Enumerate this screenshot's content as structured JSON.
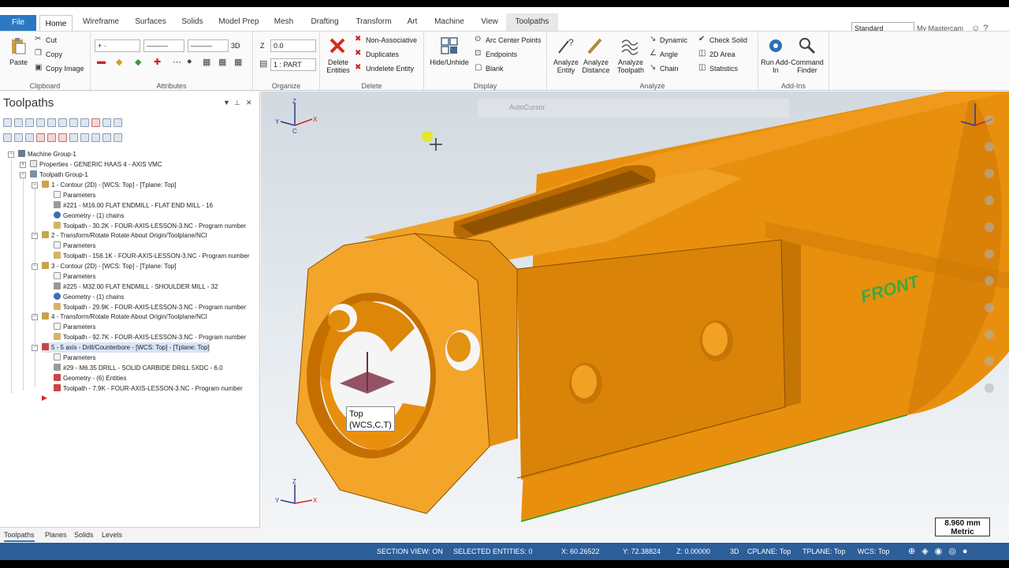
{
  "ribbon_tabs": [
    "File",
    "Home",
    "Wireframe",
    "Surfaces",
    "Solids",
    "Model Prep",
    "Mesh",
    "Drafting",
    "Transform",
    "Art",
    "Machine",
    "View",
    "Toolpaths"
  ],
  "active_tab": "Home",
  "top_right": {
    "standard": "Standard",
    "my_mastercam": "My Mastercam"
  },
  "clipboard": {
    "paste": "Paste",
    "cut": "Cut",
    "copy": "Copy",
    "copy_image": "Copy Image",
    "label": "Clipboard"
  },
  "attributes": {
    "mode": "3D",
    "label": "Attributes"
  },
  "organize": {
    "z_label": "Z",
    "z_value": "0.0",
    "level_value": "1 : PART",
    "label": "Organize"
  },
  "delete": {
    "delete_entities": "Delete Entities",
    "non_associative": "Non-Associative",
    "duplicates": "Duplicates",
    "undelete_entity": "Undelete Entity",
    "label": "Delete"
  },
  "display": {
    "hide_unhide": "Hide/Unhide",
    "arc_center_points": "Arc Center Points",
    "endpoints": "Endpoints",
    "blank": "Blank",
    "label": "Display"
  },
  "analyze": {
    "analyze_entity": "Analyze Entity",
    "analyze_distance": "Analyze Distance",
    "analyze_toolpath": "Analyze Toolpath",
    "dynamic": "Dynamic",
    "angle": "Angle",
    "chain": "Chain",
    "check_solid": "Check Solid",
    "area_2d": "2D Area",
    "statistics": "Statistics",
    "label": "Analyze"
  },
  "addins": {
    "run_addin": "Run Add-In",
    "command_finder": "Command Finder",
    "label": "Add-Ins"
  },
  "panel": {
    "title": "Toolpaths",
    "tabs": [
      "Toolpaths",
      "Planes",
      "Solids",
      "Levels"
    ],
    "tree": [
      "Machine Group-1",
      "Properties - GENERIC HAAS 4 - AXIS VMC",
      "Toolpath Group-1",
      "1 - Contour (2D) - [WCS: Top] - [Tplane: Top]",
      "Parameters",
      "#221 - M16.00 FLAT ENDMILL - FLAT END MILL - 16",
      "Geometry - (1) chains",
      "Toolpath - 30.2K - FOUR-AXIS-LESSON-3.NC - Program number",
      "2 - Transform/Rotate Rotate About Origin/Toolplane/NCI",
      "Parameters",
      "Toolpath - 156.1K - FOUR-AXIS-LESSON-3.NC - Program number",
      "3 - Contour (2D) - [WCS: Top] - [Tplane: Top]",
      "Parameters",
      "#225 - M32.00 FLAT ENDMILL - SHOULDER MILL - 32",
      "Geometry - (1) chains",
      "Toolpath - 29.9K - FOUR-AXIS-LESSON-3.NC - Program number",
      "4 - Transform/Rotate Rotate About Origin/Toolplane/NCI",
      "Parameters",
      "Toolpath - 92.7K - FOUR-AXIS-LESSON-3.NC - Program number",
      "5 - 5 axis - Drill/Counterbore - [WCS: Top] - [Tplane: Top]",
      "Parameters",
      "#29 - M6.35 DRILL - SOLID CARBIDE DRILL 5XDC - 6.0",
      "Geometry - (6) Entities",
      "Toolpath - 7.9K - FOUR-AXIS-LESSON-3.NC - Program number"
    ]
  },
  "viewport": {
    "tooltip_line1": "Top",
    "tooltip_line2": "(WCS,C,T)",
    "front_label": "FRONT",
    "autocursor": "AutoCursor",
    "scale_value": "8.960 mm",
    "scale_unit": "Metric",
    "axis_x": "X",
    "axis_y": "Y",
    "axis_z": "Z",
    "axis_c": "C",
    "part_color": "#e8900e"
  },
  "status": {
    "section_view": "SECTION VIEW: ON",
    "selected_entities": "SELECTED ENTITIES: 0",
    "x": "X: 60.26522",
    "y": "Y: 72.38824",
    "z": "Z: 0.00000",
    "mode": "3D",
    "cplane": "CPLANE: Top",
    "tplane": "TPLANE: Top",
    "wcs": "WCS: Top"
  }
}
